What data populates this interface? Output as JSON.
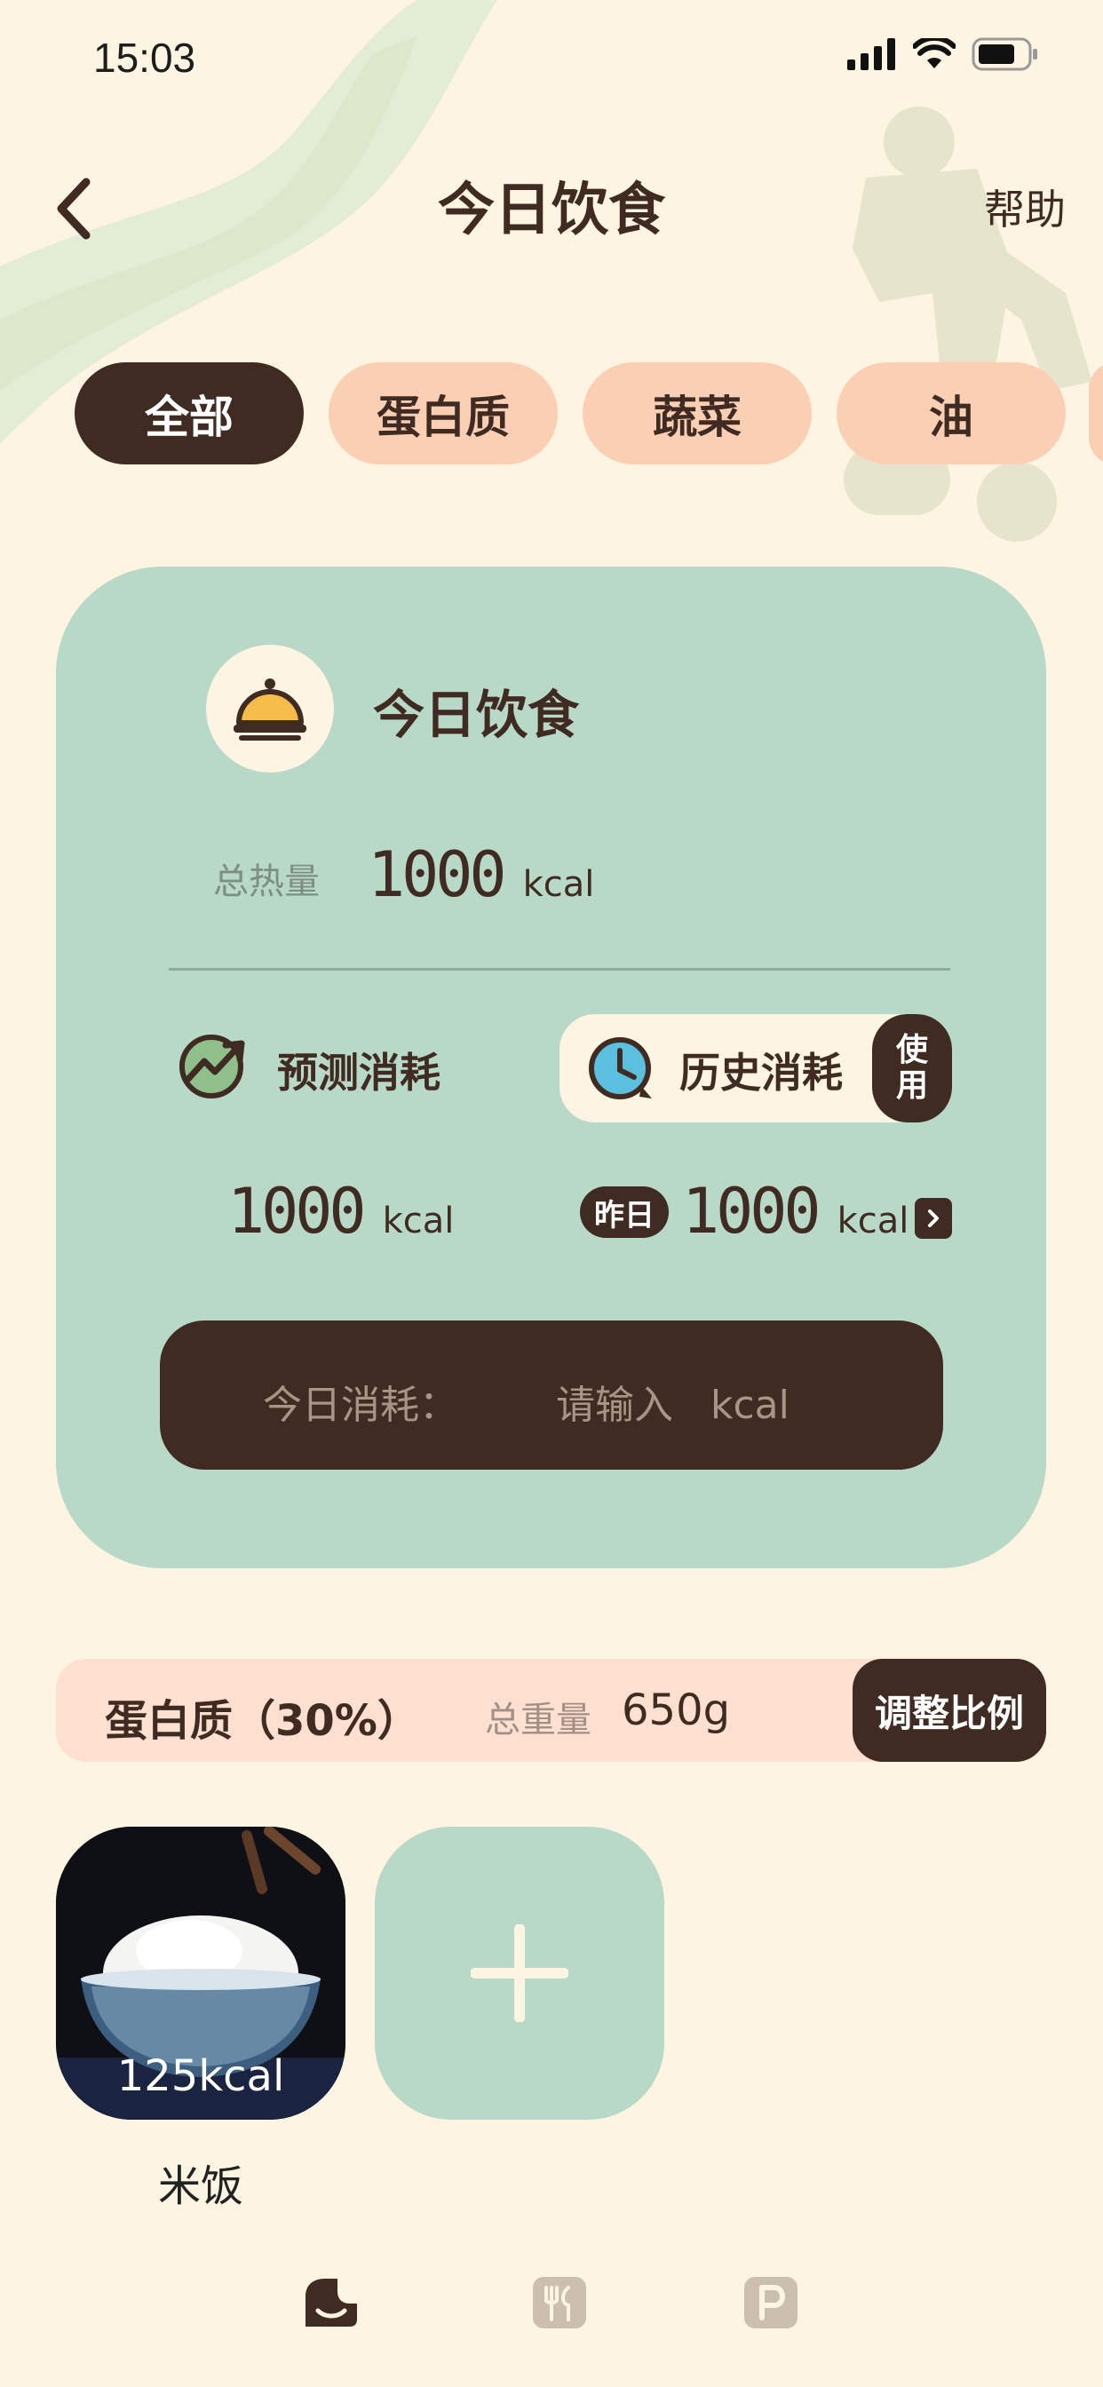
{
  "status": {
    "time": "15:03"
  },
  "header": {
    "title": "今日饮食",
    "help": "帮助"
  },
  "tabs": [
    {
      "label": "全部",
      "active": true
    },
    {
      "label": "蛋白质",
      "active": false
    },
    {
      "label": "蔬菜",
      "active": false
    },
    {
      "label": "油",
      "active": false
    }
  ],
  "card": {
    "title": "今日饮食",
    "total_label": "总热量",
    "total_value": "1000",
    "total_unit": "kcal",
    "predict_label": "预测消耗",
    "predict_value": "1000",
    "predict_unit": "kcal",
    "history_label": "历史消耗",
    "use_label_1": "使",
    "use_label_2": "用",
    "yesterday_badge": "昨日",
    "history_value": "1000",
    "history_unit": "kcal",
    "today_label": "今日消耗：",
    "input_placeholder": "请输入",
    "input_unit": "kcal"
  },
  "section": {
    "title": "蛋白质（30%）",
    "weight_label": "总重量",
    "weight_value": "650g",
    "adjust_button": "调整比例"
  },
  "foods": [
    {
      "name": "米饭",
      "calories": "125kcal"
    }
  ],
  "colors": {
    "brown": "#3f2b21",
    "mint": "#b8d8c8",
    "peach": "#fbcfb3",
    "cream": "#fdf4e1"
  }
}
